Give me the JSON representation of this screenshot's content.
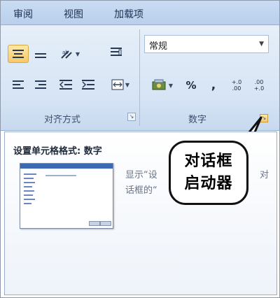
{
  "tabs": [
    "审阅",
    "视图",
    "加载项"
  ],
  "ribbon": {
    "alignment_group_label": "对齐方式",
    "number_group_label": "数字",
    "number_format_value": "常规",
    "percent_symbol": "%",
    "comma_symbol": ",",
    "increase_decimal": "+.0\n.00",
    "decrease_decimal": ".00\n+.0"
  },
  "tooltip": {
    "title": "设置单元格格式: 数字",
    "text_line1": "显示“设",
    "text_line1_end": "对",
    "text_line2": "话框的“"
  },
  "callout": {
    "line1": "对话框",
    "line2": "启动器"
  },
  "colors": {
    "ribbon_bg": "#d6e4f5",
    "highlight": "#f8c96a",
    "text": "#1b2f52"
  }
}
